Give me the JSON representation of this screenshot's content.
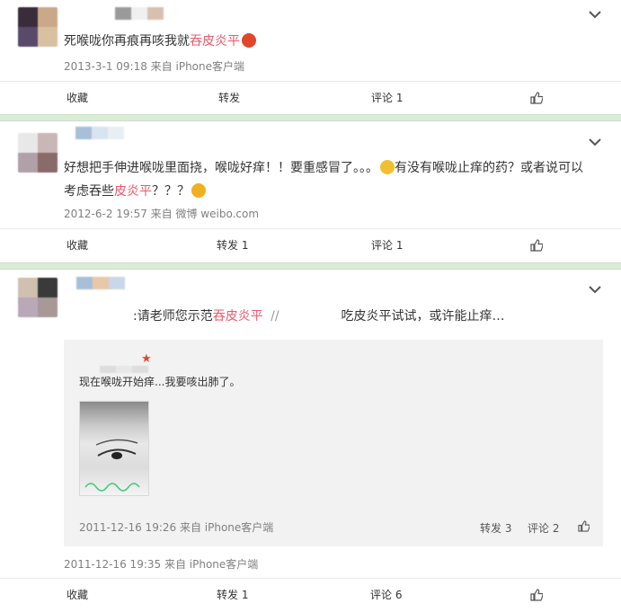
{
  "posts": [
    {
      "content_prefix": "死喉咙你再痕再咳我就",
      "content_highlight": "吞皮炎平",
      "meta": "2013-3-1 09:18 来自 iPhone客户端",
      "actions": {
        "favorite": "收藏",
        "repost": "转发",
        "comment": "评论 1"
      }
    },
    {
      "content_line1": "好想把手伸进喉咙里面挠，喉咙好痒！！要重感冒了。。。",
      "content_line1b": "有没有喉咙止痒的药？或者说可以",
      "content_line2_prefix": "考虑吞些",
      "content_highlight": "皮炎平",
      "content_line2_suffix": "？？？",
      "meta": "2012-6-2 19:57 来自 微博 weibo.com",
      "actions": {
        "favorite": "收藏",
        "repost": "转发 1",
        "comment": "评论 1"
      }
    },
    {
      "content_prefix": ":请老师您示范",
      "content_highlight": "吞皮炎平",
      "content_sep": "//",
      "content_suffix": "吃皮炎平试试，或许能止痒…",
      "repost": {
        "star": "★",
        "text": "现在喉咙开始痒...我要咳出肺了。",
        "meta": "2011-12-16 19:26 来自 iPhone客户端",
        "repost_label": "转发 3",
        "comment_label": "评论 2"
      },
      "meta": "2011-12-16 19:35 来自 iPhone客户端",
      "actions": {
        "favorite": "收藏",
        "repost": "转发 1",
        "comment": "评论 6"
      }
    }
  ],
  "icons": {
    "chevron": "chevron-down-icon",
    "like": "thumbs-up-icon",
    "emoji": "emoji-icon"
  },
  "colors": {
    "highlight": "#eb5a6c",
    "meta": "#808080",
    "divider": "#dcebd8",
    "repost_bg": "#f2f2f2"
  }
}
